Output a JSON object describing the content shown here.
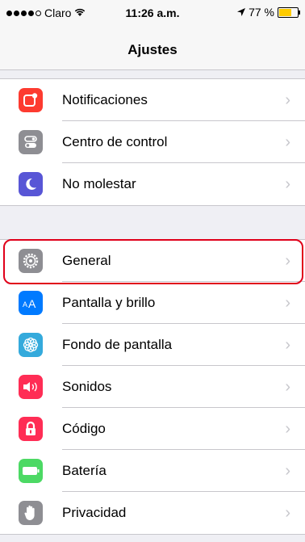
{
  "status": {
    "carrier": "Claro",
    "time": "11:26 a.m.",
    "battery_text": "77 %",
    "battery_level": 0.77,
    "battery_color": "#ffcc00"
  },
  "nav": {
    "title": "Ajustes"
  },
  "groups": [
    {
      "items": [
        {
          "label": "Notificaciones",
          "icon": "notifications-icon",
          "color": "#fd3b30"
        },
        {
          "label": "Centro de control",
          "icon": "control-center-icon",
          "color": "#8e8e93"
        },
        {
          "label": "No molestar",
          "icon": "moon-icon",
          "color": "#5856d6"
        }
      ]
    },
    {
      "items": [
        {
          "label": "General",
          "icon": "gear-icon",
          "color": "#8e8e93"
        },
        {
          "label": "Pantalla y brillo",
          "icon": "display-brightness-icon",
          "color": "#007aff"
        },
        {
          "label": "Fondo de pantalla",
          "icon": "wallpaper-icon",
          "color": "#34aadc"
        },
        {
          "label": "Sonidos",
          "icon": "sound-icon",
          "color": "#ff2d55"
        },
        {
          "label": "Código",
          "icon": "lock-icon",
          "color": "#ff2d55"
        },
        {
          "label": "Batería",
          "icon": "battery-icon",
          "color": "#4cd964"
        },
        {
          "label": "Privacidad",
          "icon": "hand-icon",
          "color": "#8e8e93"
        }
      ]
    }
  ],
  "highlight_color": "#e0001a",
  "chevron": "›"
}
